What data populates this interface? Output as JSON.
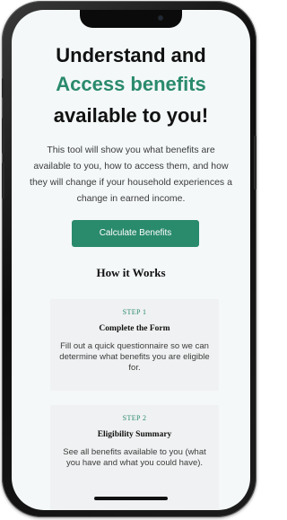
{
  "hero": {
    "line1": "Understand and",
    "line2": "Access benefits",
    "line3": "available to you!",
    "intro": "This tool will show you what benefits are available to you, how to access them, and how they will change if your household experiences a change in earned income."
  },
  "cta": {
    "label": "Calculate Benefits"
  },
  "how_it_works": {
    "title": "How it Works",
    "steps": [
      {
        "label": "STEP 1",
        "title": "Complete the Form",
        "description": "Fill out a quick questionnaire so we can determine what benefits you are eligible for."
      },
      {
        "label": "STEP 2",
        "title": "Eligibility Summary",
        "description": "See all benefits available to you (what you have and what you could have)."
      }
    ]
  },
  "colors": {
    "accent": "#2a8a6c",
    "background": "#f4f8f9",
    "card": "#f0f1f2"
  }
}
